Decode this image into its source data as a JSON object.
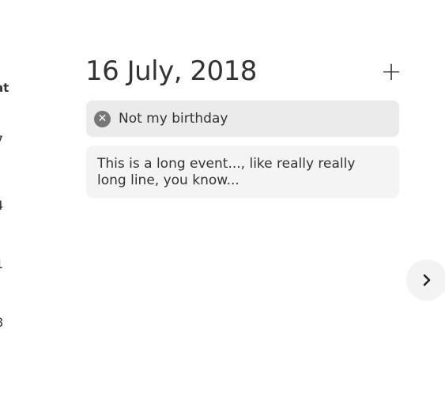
{
  "calendar_column": {
    "header": "at",
    "cells": [
      "7",
      "4",
      "1",
      "8"
    ]
  },
  "day": {
    "title": "16 July, 2018",
    "add_label": "+"
  },
  "events": [
    {
      "text": "Not my birthday",
      "remove_icon": "close-icon"
    },
    {
      "text": "This is a long event..., like really really long line, you know..."
    }
  ],
  "navigation": {
    "next_icon": "chevron-right-icon"
  }
}
